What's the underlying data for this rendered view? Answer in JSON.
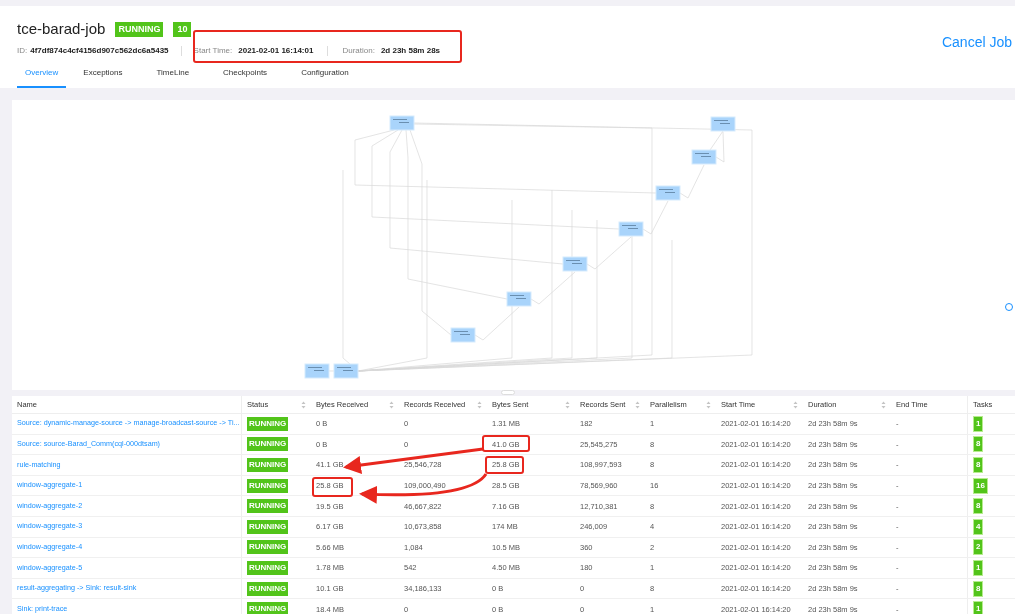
{
  "job": {
    "name": "tce-barad-job",
    "status": "RUNNING",
    "task_count": "10",
    "id_label": "ID:",
    "id": "4f7df874c4cf4156d907c562dc6a5435",
    "start_label": "Start Time:",
    "start": "2021-02-01 16:14:01",
    "duration_label": "Duration:",
    "duration": "2d 23h 58m 28s",
    "cancel": "Cancel Job"
  },
  "tabs": [
    {
      "label": "Overview",
      "selected": true
    },
    {
      "label": "Exceptions",
      "selected": false
    },
    {
      "label": "TimeLine",
      "selected": false
    },
    {
      "label": "Checkpoints",
      "selected": false
    },
    {
      "label": "Configuration",
      "selected": false
    }
  ],
  "table": {
    "columns": [
      "Name",
      "Status",
      "Bytes Received",
      "Records Received",
      "Bytes Sent",
      "Records Sent",
      "Parallelism",
      "Start Time",
      "Duration",
      "End Time",
      "Tasks"
    ],
    "rows": [
      [
        "Source: dynamic-manage-source -> manage-broadcast-source -> Ti...",
        "RUNNING",
        "0 B",
        "0",
        "1.31 MB",
        "182",
        "1",
        "2021-02-01 16:14:20",
        "2d 23h 58m 9s",
        "-",
        "1"
      ],
      [
        "Source: source-Barad_Comm(cql-000dtsam)",
        "RUNNING",
        "0 B",
        "0",
        "41.0 GB",
        "25,545,275",
        "8",
        "2021-02-01 16:14:20",
        "2d 23h 58m 9s",
        "-",
        "8"
      ],
      [
        "rule-matching",
        "RUNNING",
        "41.1 GB",
        "25,546,728",
        "25.8 GB",
        "108,997,593",
        "8",
        "2021-02-01 16:14:20",
        "2d 23h 58m 9s",
        "-",
        "8"
      ],
      [
        "window-aggregate-1",
        "RUNNING",
        "25.8 GB",
        "109,000,490",
        "28.5 GB",
        "78,569,960",
        "16",
        "2021-02-01 16:14:20",
        "2d 23h 58m 9s",
        "-",
        "16"
      ],
      [
        "window-aggregate-2",
        "RUNNING",
        "19.5 GB",
        "46,667,822",
        "7.16 GB",
        "12,710,381",
        "8",
        "2021-02-01 16:14:20",
        "2d 23h 58m 9s",
        "-",
        "8"
      ],
      [
        "window-aggregate-3",
        "RUNNING",
        "6.17 GB",
        "10,673,858",
        "174 MB",
        "246,009",
        "4",
        "2021-02-01 16:14:20",
        "2d 23h 58m 9s",
        "-",
        "4"
      ],
      [
        "window-aggregate-4",
        "RUNNING",
        "5.66 MB",
        "1,084",
        "10.5 MB",
        "360",
        "2",
        "2021-02-01 16:14:20",
        "2d 23h 58m 9s",
        "-",
        "2"
      ],
      [
        "window-aggregate-5",
        "RUNNING",
        "1.78 MB",
        "542",
        "4.50 MB",
        "180",
        "1",
        "2021-02-01 16:14:20",
        "2d 23h 58m 9s",
        "-",
        "1"
      ],
      [
        "result-aggregating -> Sink: result-sink",
        "RUNNING",
        "10.1 GB",
        "34,186,133",
        "0 B",
        "0",
        "8",
        "2021-02-01 16:14:20",
        "2d 23h 58m 9s",
        "-",
        "8"
      ],
      [
        "Sink: print-trace",
        "RUNNING",
        "18.4 MB",
        "0",
        "0 B",
        "0",
        "1",
        "2021-02-01 16:14:20",
        "2d 23h 58m 9s",
        "-",
        "1"
      ]
    ]
  }
}
